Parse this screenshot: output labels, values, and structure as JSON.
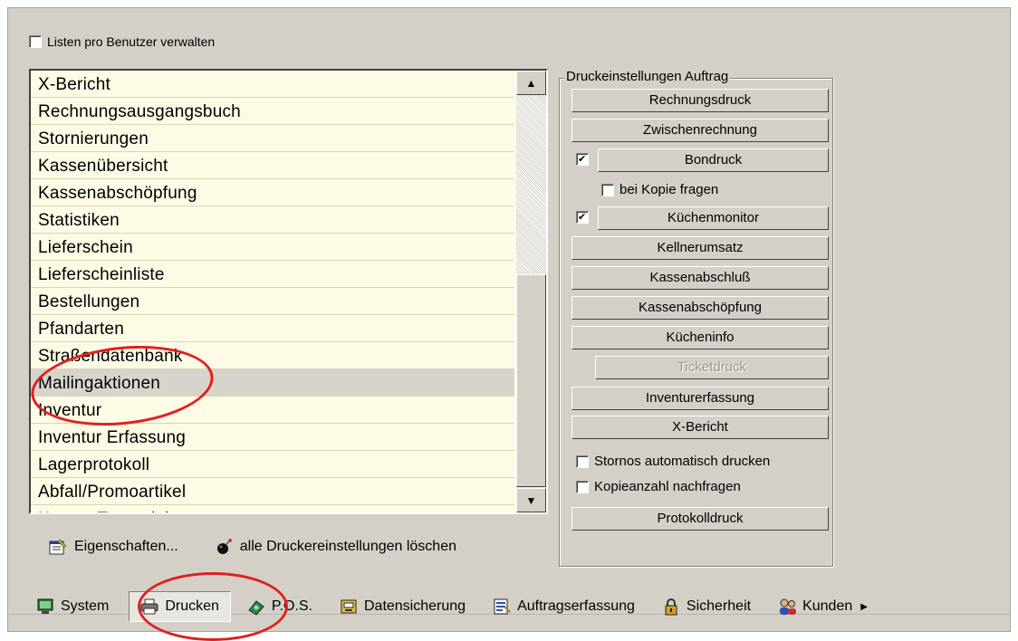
{
  "manage_per_user": {
    "label": "Listen pro Benutzer verwalten",
    "checked": false
  },
  "list": {
    "items": [
      "X-Bericht",
      "Rechnungsausgangsbuch",
      "Stornierungen",
      "Kassenübersicht",
      "Kassenabschöpfung",
      "Statistiken",
      "Lieferschein",
      "Lieferscheinliste",
      "Bestellungen",
      "Pfandarten",
      "Straßendatenbank",
      "Mailingaktionen",
      "Inventur",
      "Inventur Erfassung",
      "Lagerprotokoll",
      "Abfall/Promoartikel",
      "Kosten Transaktion"
    ],
    "selected": "Mailingaktionen"
  },
  "bottom_actions": {
    "properties": "Eigenschaften...",
    "delete_all": "alle Druckereinstellungen löschen"
  },
  "print_settings": {
    "title": "Druckeinstellungen Auftrag",
    "rechnungsdruck": "Rechnungsdruck",
    "zwischenrechnung": "Zwischenrechnung",
    "bondruck": "Bondruck",
    "bondruck_checked": true,
    "bei_kopie_fragen": "bei Kopie fragen",
    "bei_kopie_checked": false,
    "kuechenmonitor": "Küchenmonitor",
    "kuechenmonitor_checked": true,
    "kellnerumsatz": "Kellnerumsatz",
    "kassenabschluss": "Kassenabschluß",
    "kassenabschoepfung": "Kassenabschöpfung",
    "kuecheninfo": "Kücheninfo",
    "ticketdruck": "Ticketdruck",
    "inventurerfassung": "Inventurerfassung",
    "x_bericht": "X-Bericht",
    "stornos_auto": "Stornos automatisch drucken",
    "stornos_auto_checked": false,
    "kopieanzahl": "Kopieanzahl nachfragen",
    "kopieanzahl_checked": false,
    "protokolldruck": "Protokolldruck"
  },
  "toolbar": {
    "system": "System",
    "drucken": "Drucken",
    "pos": "P.O.S.",
    "datensicherung": "Datensicherung",
    "auftragserfassung": "Auftragserfassung",
    "sicherheit": "Sicherheit",
    "kunden": "Kunden",
    "active": "Drucken"
  },
  "colors": {
    "window_bg": "#d4d0c8",
    "list_bg": "#fdfbe6",
    "selected_row": "#d8d4cc",
    "annotation": "#e02020"
  }
}
